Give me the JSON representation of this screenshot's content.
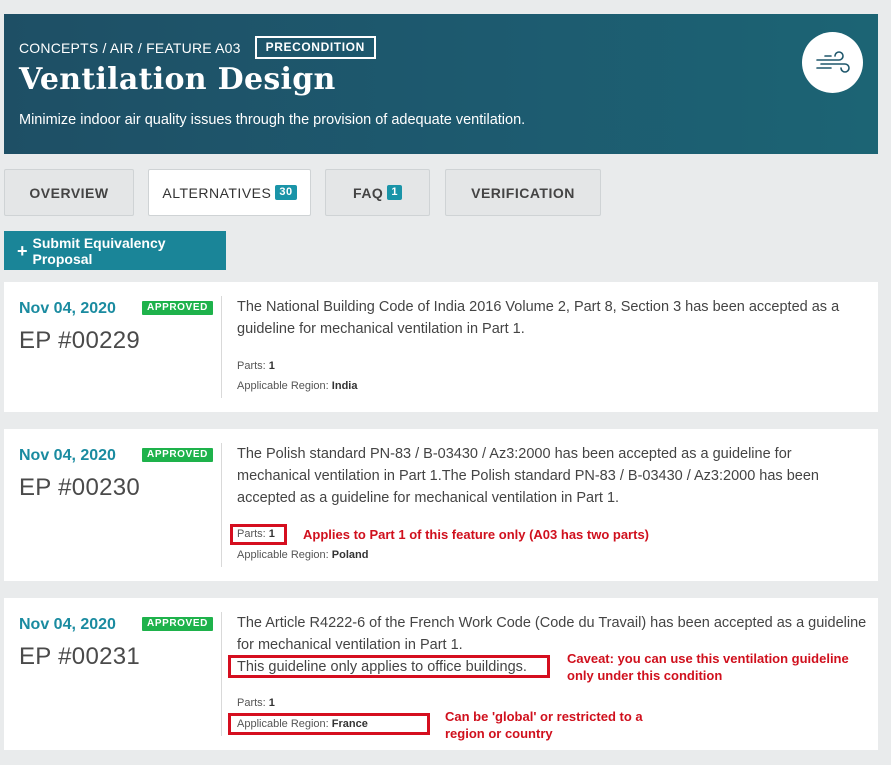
{
  "header": {
    "breadcrumb": "CONCEPTS / AIR / FEATURE A03",
    "badge": "PRECONDITION",
    "title": "Ventilation Design",
    "subtitle": "Minimize indoor air quality issues through the provision of adequate ventilation.",
    "icon": "wind-icon"
  },
  "tabs": [
    {
      "label": "OVERVIEW",
      "count": null,
      "active": false
    },
    {
      "label": "ALTERNATIVES",
      "count": "30",
      "active": true
    },
    {
      "label": "FAQ",
      "count": "1",
      "active": false
    },
    {
      "label": "VERIFICATION",
      "count": null,
      "active": false
    }
  ],
  "submit_button": {
    "icon": "plus-icon",
    "label": "Submit Equivalency Proposal"
  },
  "proposals": [
    {
      "date": "Nov 04, 2020",
      "status": "APPROVED",
      "ep": "EP #00229",
      "description": "The National Building Code of India 2016 Volume 2, Part 8, Section 3 has been accepted as a guideline for mechanical ventilation in Part 1.",
      "parts_label": "Parts:",
      "parts": "1",
      "region_label": "Applicable Region:",
      "region": "India"
    },
    {
      "date": "Nov 04, 2020",
      "status": "APPROVED",
      "ep": "EP #00230",
      "description": "The Polish standard PN-83 / B-03430 / Az3:2000 has been accepted as a guideline for mechanical ventilation in Part 1.The Polish standard PN-83 / B-03430 / Az3:2000 has been accepted as a guideline for mechanical ventilation in Part 1.",
      "parts_label": "Parts:",
      "parts": "1",
      "region_label": "Applicable Region:",
      "region": "Poland"
    },
    {
      "date": "Nov 04, 2020",
      "status": "APPROVED",
      "ep": "EP #00231",
      "description": "The Article R4222-6 of the French Work Code (Code du Travail) has been accepted as a guideline for mechanical ventilation in Part 1.",
      "caveat": "This guideline only applies to office buildings.",
      "parts_label": "Parts:",
      "parts": "1",
      "region_label": "Applicable Region:",
      "region": "France"
    }
  ],
  "annotations": {
    "parts_note": "Applies to Part 1 of this feature only (A03 has two parts)",
    "caveat_note_1": "Caveat: you can use this ventilation guideline",
    "caveat_note_2": "only under this condition",
    "region_note_1": "Can be 'global' or restricted to a",
    "region_note_2": "region or country"
  },
  "colors": {
    "header_bg": "#1e566b",
    "accent": "#1a8598",
    "approved": "#1eb24b",
    "annotation_red": "#d50e1f"
  }
}
